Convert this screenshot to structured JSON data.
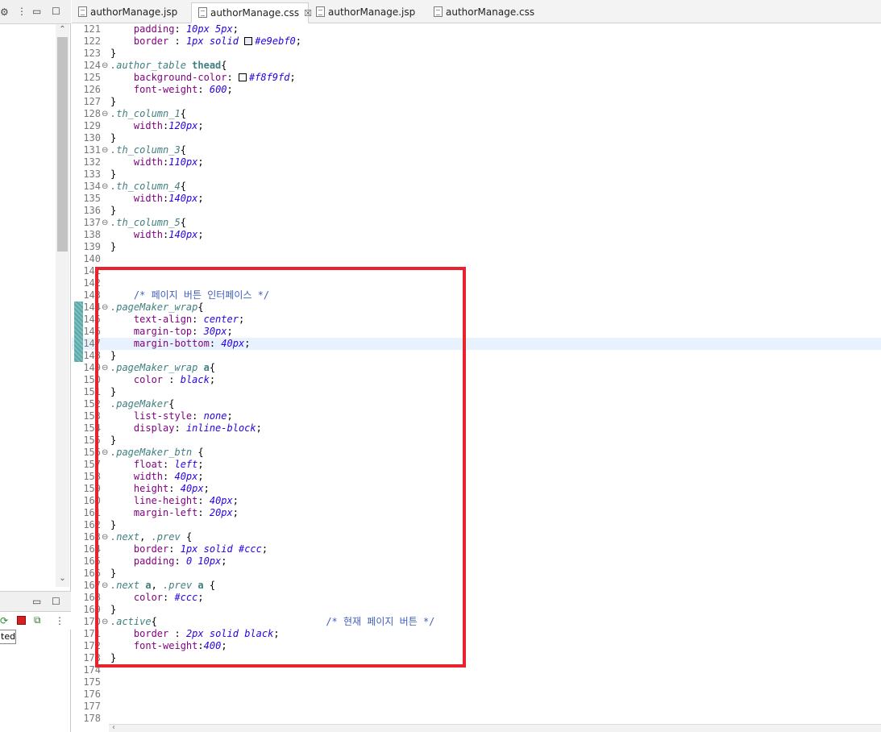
{
  "tabs": [
    {
      "label": "authorManage.jsp",
      "active": false
    },
    {
      "label": "authorManage.css",
      "active": true,
      "close": "☒"
    },
    {
      "label": "authorManage.jsp",
      "active": false
    },
    {
      "label": "authorManage.css",
      "active": false
    }
  ],
  "left_panel": {
    "console_label": "ted]"
  },
  "editor": {
    "lines": [
      {
        "n": "121",
        "fold": false,
        "parts": [
          [
            "punct",
            "    "
          ],
          [
            "prop",
            "padding"
          ],
          [
            "punct",
            ": "
          ],
          [
            "val",
            "10px 5px"
          ],
          [
            "punct",
            ";"
          ]
        ]
      },
      {
        "n": "122",
        "fold": false,
        "parts": [
          [
            "punct",
            "    "
          ],
          [
            "prop",
            "border"
          ],
          [
            "punct",
            " : "
          ],
          [
            "val",
            "1px solid "
          ],
          [
            "swatch",
            "#e9ebf0"
          ],
          [
            "val",
            "#e9ebf0"
          ],
          [
            "punct",
            ";"
          ]
        ]
      },
      {
        "n": "123",
        "fold": false,
        "parts": [
          [
            "punct",
            "}"
          ]
        ]
      },
      {
        "n": "124",
        "fold": true,
        "parts": [
          [
            "sel",
            ".author_table "
          ],
          [
            "tag",
            "thead"
          ],
          [
            "punct",
            "{"
          ]
        ]
      },
      {
        "n": "125",
        "fold": false,
        "parts": [
          [
            "punct",
            "    "
          ],
          [
            "prop",
            "background-color"
          ],
          [
            "punct",
            ": "
          ],
          [
            "swatch",
            "#f8f9fd"
          ],
          [
            "val",
            "#f8f9fd"
          ],
          [
            "punct",
            ";"
          ]
        ]
      },
      {
        "n": "126",
        "fold": false,
        "parts": [
          [
            "punct",
            "    "
          ],
          [
            "prop",
            "font-weight"
          ],
          [
            "punct",
            ": "
          ],
          [
            "val",
            "600"
          ],
          [
            "punct",
            ";"
          ]
        ]
      },
      {
        "n": "127",
        "fold": false,
        "parts": [
          [
            "punct",
            "}"
          ]
        ]
      },
      {
        "n": "128",
        "fold": true,
        "parts": [
          [
            "sel",
            ".th_column_1"
          ],
          [
            "punct",
            "{"
          ]
        ]
      },
      {
        "n": "129",
        "fold": false,
        "parts": [
          [
            "punct",
            "    "
          ],
          [
            "prop",
            "width"
          ],
          [
            "punct",
            ":"
          ],
          [
            "val",
            "120px"
          ],
          [
            "punct",
            ";"
          ]
        ]
      },
      {
        "n": "130",
        "fold": false,
        "parts": [
          [
            "punct",
            "}"
          ]
        ]
      },
      {
        "n": "131",
        "fold": true,
        "parts": [
          [
            "sel",
            ".th_column_3"
          ],
          [
            "punct",
            "{"
          ]
        ]
      },
      {
        "n": "132",
        "fold": false,
        "parts": [
          [
            "punct",
            "    "
          ],
          [
            "prop",
            "width"
          ],
          [
            "punct",
            ":"
          ],
          [
            "val",
            "110px"
          ],
          [
            "punct",
            ";"
          ]
        ]
      },
      {
        "n": "133",
        "fold": false,
        "parts": [
          [
            "punct",
            "}"
          ]
        ]
      },
      {
        "n": "134",
        "fold": true,
        "parts": [
          [
            "sel",
            ".th_column_4"
          ],
          [
            "punct",
            "{"
          ]
        ]
      },
      {
        "n": "135",
        "fold": false,
        "parts": [
          [
            "punct",
            "    "
          ],
          [
            "prop",
            "width"
          ],
          [
            "punct",
            ":"
          ],
          [
            "val",
            "140px"
          ],
          [
            "punct",
            ";"
          ]
        ]
      },
      {
        "n": "136",
        "fold": false,
        "parts": [
          [
            "punct",
            "}"
          ]
        ]
      },
      {
        "n": "137",
        "fold": true,
        "parts": [
          [
            "sel",
            ".th_column_5"
          ],
          [
            "punct",
            "{"
          ]
        ]
      },
      {
        "n": "138",
        "fold": false,
        "parts": [
          [
            "punct",
            "    "
          ],
          [
            "prop",
            "width"
          ],
          [
            "punct",
            ":"
          ],
          [
            "val",
            "140px"
          ],
          [
            "punct",
            ";"
          ]
        ]
      },
      {
        "n": "139",
        "fold": false,
        "parts": [
          [
            "punct",
            "}"
          ]
        ]
      },
      {
        "n": "140",
        "fold": false,
        "parts": []
      },
      {
        "n": "141",
        "fold": false,
        "parts": []
      },
      {
        "n": "142",
        "fold": false,
        "parts": []
      },
      {
        "n": "143",
        "fold": false,
        "parts": [
          [
            "punct",
            "    "
          ],
          [
            "cmt",
            "/* 페이지 버튼 인터페이스 */"
          ]
        ]
      },
      {
        "n": "144",
        "fold": true,
        "diff": true,
        "parts": [
          [
            "sel",
            ".pageMaker_wrap"
          ],
          [
            "punct",
            "{"
          ]
        ]
      },
      {
        "n": "145",
        "fold": false,
        "diff": true,
        "parts": [
          [
            "punct",
            "    "
          ],
          [
            "prop",
            "text-align"
          ],
          [
            "punct",
            ": "
          ],
          [
            "val",
            "center"
          ],
          [
            "punct",
            ";"
          ]
        ]
      },
      {
        "n": "146",
        "fold": false,
        "diff": true,
        "parts": [
          [
            "punct",
            "    "
          ],
          [
            "prop",
            "margin-top"
          ],
          [
            "punct",
            ": "
          ],
          [
            "val",
            "30px"
          ],
          [
            "punct",
            ";"
          ]
        ]
      },
      {
        "n": "147",
        "fold": false,
        "diff": true,
        "current": true,
        "parts": [
          [
            "punct",
            "    "
          ],
          [
            "prop",
            "margin-bottom"
          ],
          [
            "punct",
            ": "
          ],
          [
            "val",
            "40px"
          ],
          [
            "punct",
            ";"
          ]
        ]
      },
      {
        "n": "148",
        "fold": false,
        "diff": true,
        "parts": [
          [
            "punct",
            "}"
          ]
        ]
      },
      {
        "n": "149",
        "fold": true,
        "parts": [
          [
            "sel",
            ".pageMaker_wrap "
          ],
          [
            "tag",
            "a"
          ],
          [
            "punct",
            "{"
          ]
        ]
      },
      {
        "n": "150",
        "fold": false,
        "parts": [
          [
            "punct",
            "    "
          ],
          [
            "prop",
            "color"
          ],
          [
            "punct",
            " : "
          ],
          [
            "val",
            "black"
          ],
          [
            "punct",
            ";"
          ]
        ]
      },
      {
        "n": "151",
        "fold": false,
        "parts": [
          [
            "punct",
            "}"
          ]
        ]
      },
      {
        "n": "152",
        "fold": false,
        "parts": [
          [
            "sel",
            ".pageMaker"
          ],
          [
            "punct",
            "{"
          ]
        ]
      },
      {
        "n": "153",
        "fold": false,
        "parts": [
          [
            "punct",
            "    "
          ],
          [
            "prop",
            "list-style"
          ],
          [
            "punct",
            ": "
          ],
          [
            "val",
            "none"
          ],
          [
            "punct",
            ";"
          ]
        ]
      },
      {
        "n": "154",
        "fold": false,
        "parts": [
          [
            "punct",
            "    "
          ],
          [
            "prop",
            "display"
          ],
          [
            "punct",
            ": "
          ],
          [
            "val",
            "inline-block"
          ],
          [
            "punct",
            ";"
          ]
        ]
      },
      {
        "n": "155",
        "fold": false,
        "parts": [
          [
            "punct",
            "}"
          ]
        ]
      },
      {
        "n": "156",
        "fold": true,
        "parts": [
          [
            "sel",
            ".pageMaker_btn "
          ],
          [
            "punct",
            "{"
          ]
        ]
      },
      {
        "n": "157",
        "fold": false,
        "parts": [
          [
            "punct",
            "    "
          ],
          [
            "prop",
            "float"
          ],
          [
            "punct",
            ": "
          ],
          [
            "val",
            "left"
          ],
          [
            "punct",
            ";"
          ]
        ]
      },
      {
        "n": "158",
        "fold": false,
        "parts": [
          [
            "punct",
            "    "
          ],
          [
            "prop",
            "width"
          ],
          [
            "punct",
            ": "
          ],
          [
            "val",
            "40px"
          ],
          [
            "punct",
            ";"
          ]
        ]
      },
      {
        "n": "159",
        "fold": false,
        "parts": [
          [
            "punct",
            "    "
          ],
          [
            "prop",
            "height"
          ],
          [
            "punct",
            ": "
          ],
          [
            "val",
            "40px"
          ],
          [
            "punct",
            ";"
          ]
        ]
      },
      {
        "n": "160",
        "fold": false,
        "parts": [
          [
            "punct",
            "    "
          ],
          [
            "prop",
            "line-height"
          ],
          [
            "punct",
            ": "
          ],
          [
            "val",
            "40px"
          ],
          [
            "punct",
            ";"
          ]
        ]
      },
      {
        "n": "161",
        "fold": false,
        "parts": [
          [
            "punct",
            "    "
          ],
          [
            "prop",
            "margin-left"
          ],
          [
            "punct",
            ": "
          ],
          [
            "val",
            "20px"
          ],
          [
            "punct",
            ";"
          ]
        ]
      },
      {
        "n": "162",
        "fold": false,
        "parts": [
          [
            "punct",
            "}"
          ]
        ]
      },
      {
        "n": "163",
        "fold": true,
        "parts": [
          [
            "sel",
            ".next"
          ],
          [
            "punct",
            ", "
          ],
          [
            "sel",
            ".prev "
          ],
          [
            "punct",
            "{"
          ]
        ]
      },
      {
        "n": "164",
        "fold": false,
        "parts": [
          [
            "punct",
            "    "
          ],
          [
            "prop",
            "border"
          ],
          [
            "punct",
            ": "
          ],
          [
            "val",
            "1px solid #ccc"
          ],
          [
            "punct",
            ";"
          ]
        ]
      },
      {
        "n": "165",
        "fold": false,
        "parts": [
          [
            "punct",
            "    "
          ],
          [
            "prop",
            "padding"
          ],
          [
            "punct",
            ": "
          ],
          [
            "val",
            "0 10px"
          ],
          [
            "punct",
            ";"
          ]
        ]
      },
      {
        "n": "166",
        "fold": false,
        "parts": [
          [
            "punct",
            "}"
          ]
        ]
      },
      {
        "n": "167",
        "fold": true,
        "parts": [
          [
            "sel",
            ".next "
          ],
          [
            "tag",
            "a"
          ],
          [
            "punct",
            ", "
          ],
          [
            "sel",
            ".prev "
          ],
          [
            "tag",
            "a "
          ],
          [
            "punct",
            "{"
          ]
        ]
      },
      {
        "n": "168",
        "fold": false,
        "parts": [
          [
            "punct",
            "    "
          ],
          [
            "prop",
            "color"
          ],
          [
            "punct",
            ": "
          ],
          [
            "val",
            "#ccc"
          ],
          [
            "punct",
            ";"
          ]
        ]
      },
      {
        "n": "169",
        "fold": false,
        "parts": [
          [
            "punct",
            "}"
          ]
        ]
      },
      {
        "n": "170",
        "fold": true,
        "parts": [
          [
            "sel",
            ".active"
          ],
          [
            "punct",
            "{                             "
          ],
          [
            "cmt",
            "/* 현재 페이지 버튼 */"
          ]
        ]
      },
      {
        "n": "171",
        "fold": false,
        "parts": [
          [
            "punct",
            "    "
          ],
          [
            "prop",
            "border"
          ],
          [
            "punct",
            " : "
          ],
          [
            "val",
            "2px solid black"
          ],
          [
            "punct",
            ";"
          ]
        ]
      },
      {
        "n": "172",
        "fold": false,
        "parts": [
          [
            "punct",
            "    "
          ],
          [
            "prop",
            "font-weight"
          ],
          [
            "punct",
            ":"
          ],
          [
            "val",
            "400"
          ],
          [
            "punct",
            ";"
          ]
        ]
      },
      {
        "n": "173",
        "fold": false,
        "parts": [
          [
            "punct",
            "}"
          ]
        ]
      },
      {
        "n": "174",
        "fold": false,
        "parts": []
      },
      {
        "n": "175",
        "fold": false,
        "parts": []
      },
      {
        "n": "176",
        "fold": false,
        "parts": []
      },
      {
        "n": "177",
        "fold": false,
        "parts": []
      },
      {
        "n": "178",
        "fold": false,
        "parts": []
      }
    ]
  },
  "colors": {
    "highlight_box": "#e8232d",
    "current_line": "#e8f2fe"
  }
}
